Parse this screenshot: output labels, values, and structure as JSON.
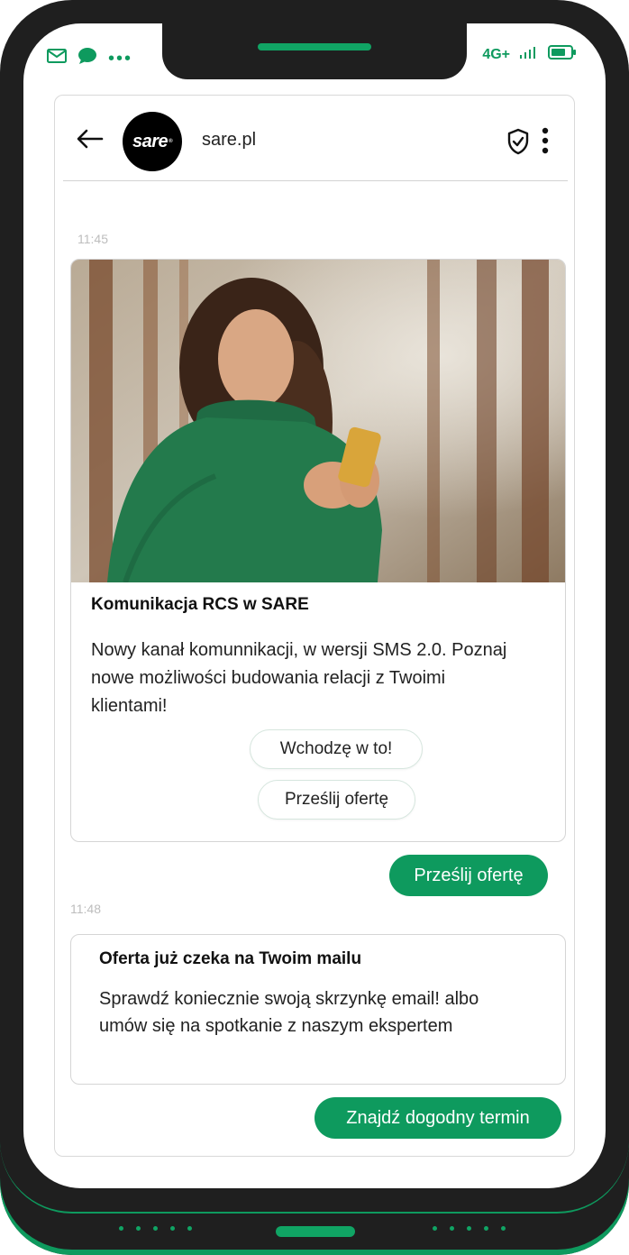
{
  "status_bar": {
    "network": "4G+",
    "icons": [
      "mail-icon",
      "chat-bubble-icon",
      "more-dots-icon",
      "signal-icon",
      "battery-icon"
    ]
  },
  "header": {
    "avatar_text": "sare",
    "sender": "sare.pl",
    "icons": [
      "back-arrow-icon",
      "shield-check-icon",
      "kebab-menu-icon"
    ]
  },
  "messages": {
    "time_1": "11:45",
    "card": {
      "title": "Komunikacja RCS w SARE",
      "body": "Nowy kanał komunnikacji, w wersji SMS 2.0. Poznaj nowe możliwości budowania relacji z Twoimi klientami!",
      "chip_1": "Wchodzę w to!",
      "chip_2": "Prześlij ofertę"
    },
    "user_reply_1": "Prześlij ofertę",
    "time_2": "11:48",
    "card_2": {
      "title": "Oferta już czeka na Twoim mailu",
      "body": "Sprawdź koniecznie swoją skrzynkę email! albo umów się na spotkanie z naszym ekspertem"
    },
    "user_reply_2": "Znajdź dogodny termin"
  },
  "colors": {
    "accent": "#0e9a5e",
    "phone_body": "#1f1f1f"
  }
}
